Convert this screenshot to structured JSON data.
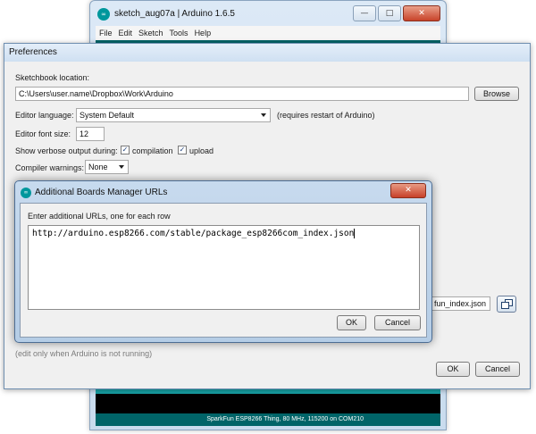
{
  "ide": {
    "title": "sketch_aug07a | Arduino 1.6.5",
    "menu": [
      "File",
      "Edit",
      "Sketch",
      "Tools",
      "Help"
    ],
    "status": "SparkFun ESP8266 Thing, 80 MHz, 115200 on COM210",
    "window_buttons": {
      "minimize": "—",
      "maximize": "□",
      "close": "✕"
    }
  },
  "preferences": {
    "title": "Preferences",
    "sketchbook_label": "Sketchbook location:",
    "sketchbook_path": "C:\\Users\\user.name\\Dropbox\\Work\\Arduino",
    "browse_label": "Browse",
    "editor_language_label": "Editor language:",
    "editor_language_value": "System Default",
    "editor_language_note": "(requires restart of Arduino)",
    "font_size_label": "Editor font size:",
    "font_size_value": "12",
    "verbose_label": "Show verbose output during:",
    "compilation_label": "compilation",
    "compilation_checked": true,
    "upload_label": "upload",
    "upload_checked": true,
    "compiler_warnings_label": "Compiler warnings:",
    "compiler_warnings_value": "None",
    "urls_field_tail": "fun_index.json",
    "edit_note": "(edit only when Arduino is not running)",
    "ok_label": "OK",
    "cancel_label": "Cancel"
  },
  "boards_dialog": {
    "title": "Additional Boards Manager URLs",
    "close_glyph": "✕",
    "instruction": "Enter additional URLs, one for each row",
    "url": "http://arduino.esp8266.com/stable/package_esp8266com_index.json",
    "ok_label": "OK",
    "cancel_label": "Cancel"
  },
  "colors": {
    "arduino_teal": "#00979c",
    "toolbar_dark": "#006468",
    "editor_teal": "#17a1a5"
  }
}
